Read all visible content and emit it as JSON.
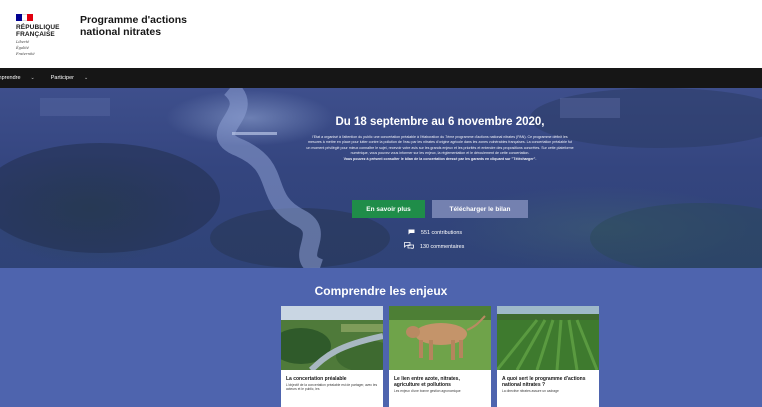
{
  "header": {
    "republic_line1": "RÉPUBLIQUE",
    "republic_line2": "FRANÇAISE",
    "motto": [
      "Liberté",
      "Égalité",
      "Fraternité"
    ],
    "site_title": "Programme d'actions national nitrates",
    "flag_colors": [
      "#000091",
      "#ffffff",
      "#e1000f"
    ]
  },
  "nav": {
    "items": [
      {
        "label": "mprendre"
      },
      {
        "label": "Participer"
      }
    ]
  },
  "hero": {
    "title": "Du 18 septembre au 6 novembre 2020,",
    "paragraph_1": "l'Etat a organisé à l'attention du public une concertation préalable à l'élaboration du 7ème programme d'actions national nitrates (PAN). Ce programme définit les mesures à mettre en place pour lutter contre la pollution de l'eau par les nitrates d'origine agricole dans les zones vulnérables françaises. La concertation préalable fut un moment privilégié pour mieux connaître le sujet, recevoir votre avis sur les grands enjeux et les priorités et entendre des propositions concrètes. Sur cette plateforme numérique, vous pouvez vous informer sur les enjeux, la réglementation et le déroulement de cette concertation.",
    "paragraph_2": "Vous pouvez à présent consulter le bilan de la concertation dressé par les garants en cliquant sur \"Télécharger\".",
    "btn_more": "En savoir plus",
    "btn_download": "Télécharger le bilan",
    "contributions": "551 contributions",
    "comments": "130 commentaires",
    "overlay_color": "#34457f"
  },
  "section": {
    "title": "Comprendre les enjeux",
    "background": "#4e64ae",
    "cards": [
      {
        "title": "La concertation préalable",
        "description": "L'objectif de la concertation préalable est de partager, avec les acteurs et le public, les"
      },
      {
        "title": "Le lien entre azote, nitrates, agriculture et pollutions",
        "description": "Les enjeux d'une bonne gestion agronomique"
      },
      {
        "title": "A quoi sert le programme d'actions national nitrates ?",
        "description": "La directive nitrates assure un cadrage"
      }
    ]
  },
  "colors": {
    "primary_button": "#1f8d49",
    "secondary_button": "#7481b0",
    "nav_background": "#161616"
  }
}
